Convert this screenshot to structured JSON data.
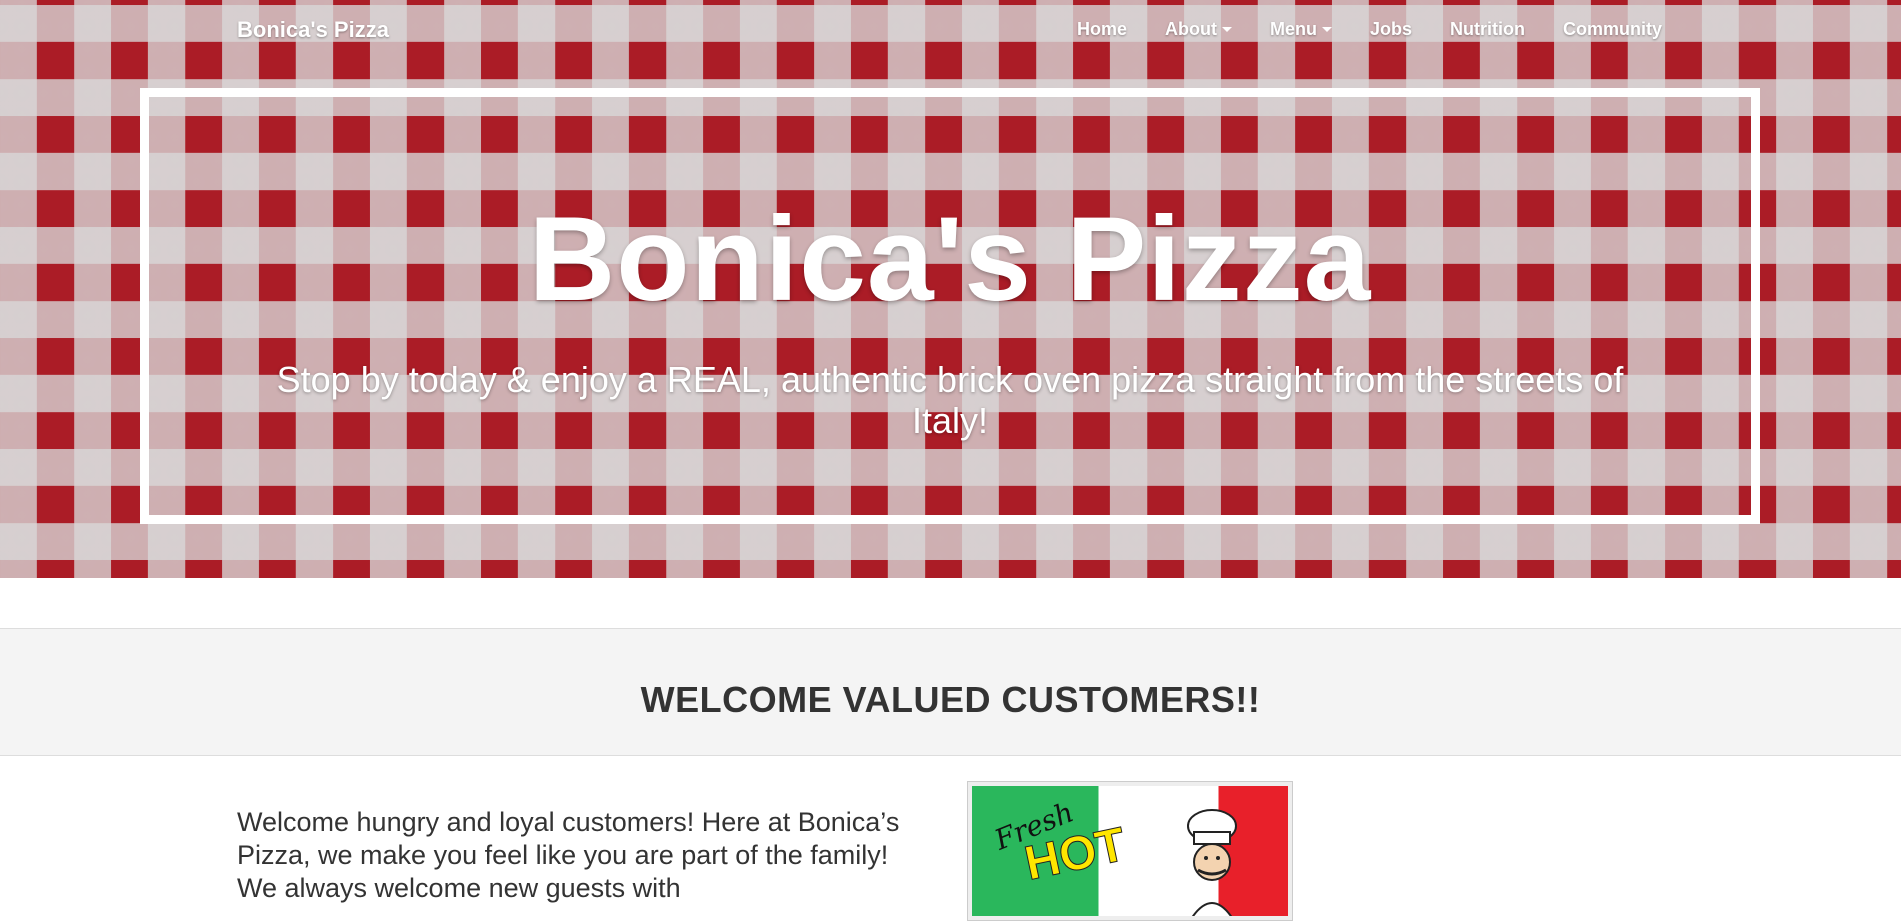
{
  "nav": {
    "brand": "Bonica's Pizza",
    "items": [
      {
        "label": "Home",
        "dropdown": false
      },
      {
        "label": "About",
        "dropdown": true
      },
      {
        "label": "Menu",
        "dropdown": true
      },
      {
        "label": "Jobs",
        "dropdown": false
      },
      {
        "label": "Nutrition",
        "dropdown": false
      },
      {
        "label": "Community",
        "dropdown": false
      }
    ]
  },
  "hero": {
    "title": "Bonica's Pizza",
    "subtitle": "Stop by today & enjoy a REAL, authentic brick oven pizza straight from the streets of Italy!"
  },
  "welcome": {
    "title": "WELCOME VALUED CUSTOMERS!!"
  },
  "intro": {
    "text": "Welcome hungry and loyal customers! Here at Bonica’s Pizza, we make you feel like you are part of the family! We always welcome new guests with"
  },
  "promo": {
    "fresh": "Fresh",
    "hot": "HOT"
  },
  "colors": {
    "gingham_red": "#b51a24",
    "welcome_band": "#f4f4f4",
    "text_dark": "#333333"
  }
}
